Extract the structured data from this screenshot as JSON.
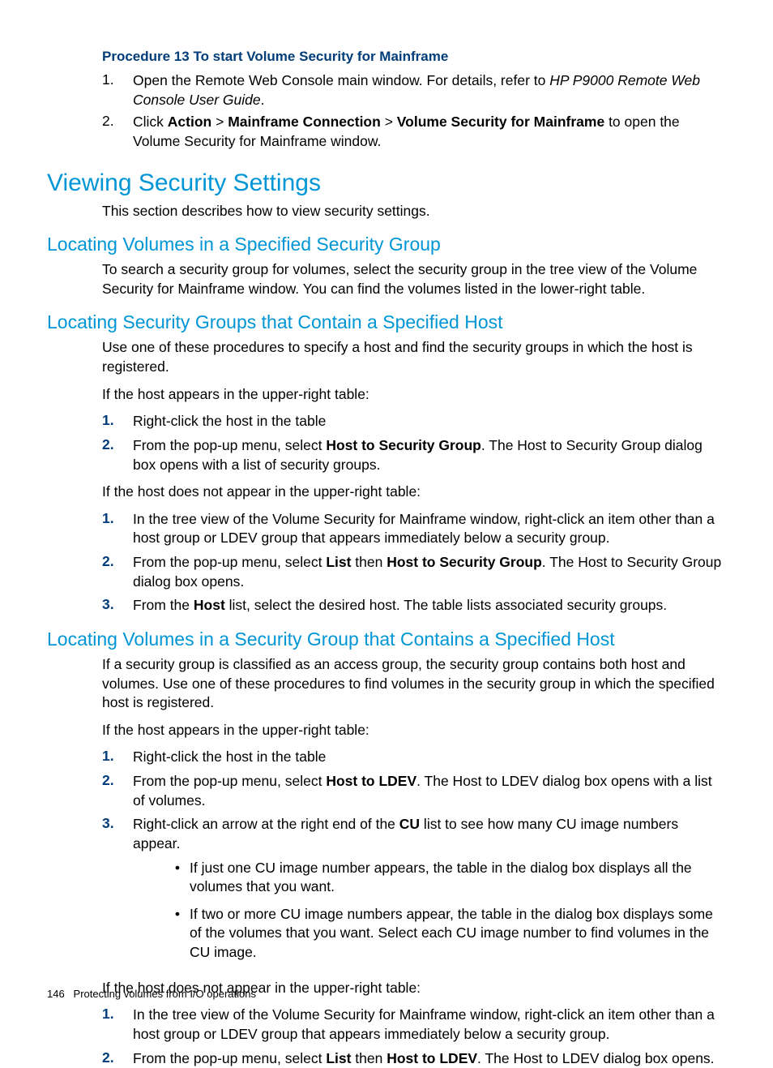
{
  "procedure13": {
    "title": "Procedure 13 To start Volume Security for Mainframe",
    "step1_pre": "Open the Remote Web Console main window. For details, refer to ",
    "step1_italic": "HP P9000 Remote Web Console User Guide",
    "step1_post": ".",
    "step2_a": "Click ",
    "step2_action": "Action",
    "step2_sep1": " > ",
    "step2_mc": "Mainframe Connection",
    "step2_sep2": " > ",
    "step2_vsm": "Volume Security for Mainframe",
    "step2_b": " to open the Volume Security for Mainframe window."
  },
  "h1": "Viewing Security Settings",
  "h1_desc": "This section describes how to view security settings.",
  "sec1": {
    "title": "Locating Volumes in a Specified Security Group",
    "p1": "To search a security group for volumes, select the security group in the tree view of the Volume Security for Mainframe window. You can find the volumes listed in the lower-right table."
  },
  "sec2": {
    "title": "Locating Security Groups that Contain a Specified Host",
    "p1": "Use one of these procedures to specify a host and find the security groups in which the host is registered.",
    "p2": "If the host appears in the upper-right table:",
    "listA_1": "Right-click the host in the table",
    "listA_2_a": "From the pop-up menu, select ",
    "listA_2_b": "Host to Security Group",
    "listA_2_c": ". The Host to Security Group dialog box opens with a list of security groups.",
    "p3": "If the host does not appear in the upper-right table:",
    "listB_1": "In the tree view of the Volume Security for Mainframe window, right-click an item other than a host group or LDEV group that appears immediately below a security group.",
    "listB_2_a": "From the pop-up menu, select ",
    "listB_2_b": "List",
    "listB_2_c": " then ",
    "listB_2_d": "Host to Security Group",
    "listB_2_e": ". The Host to Security Group dialog box opens.",
    "listB_3_a": "From the ",
    "listB_3_b": "Host",
    "listB_3_c": " list, select the desired host. The table lists associated security groups."
  },
  "sec3": {
    "title": "Locating Volumes in a Security Group that Contains a Specified Host",
    "p1": "If a security group is classified as an access group, the security group contains both host and volumes. Use one of these procedures to find volumes in the security group in which the specified host is registered.",
    "p2": "If the host appears in the upper-right table:",
    "listA_1": "Right-click the host in the table",
    "listA_2_a": "From the pop-up menu, select ",
    "listA_2_b": "Host to LDEV",
    "listA_2_c": ". The Host to LDEV dialog box opens with a list of volumes.",
    "listA_3_a": "Right-click an arrow at the right end of the ",
    "listA_3_b": "CU",
    "listA_3_c": " list to see how many CU image numbers appear.",
    "bullet1": "If just one CU image number appears, the table in the dialog box displays all the volumes that you want.",
    "bullet2": "If two or more CU image numbers appear, the table in the dialog box displays some of the volumes that you want. Select each CU image number to find volumes in the CU image.",
    "p3": "If the host does not appear in the upper-right table:",
    "listB_1": "In the tree view of the Volume Security for Mainframe window, right-click an item other than a host group or LDEV group that appears immediately below a security group.",
    "listB_2_a": "From the pop-up menu, select ",
    "listB_2_b": "List",
    "listB_2_c": " then ",
    "listB_2_d": "Host to LDEV",
    "listB_2_e": ". The Host to LDEV dialog box opens."
  },
  "footer": {
    "page": "146",
    "label": "Protecting volumes from I/O operations"
  }
}
